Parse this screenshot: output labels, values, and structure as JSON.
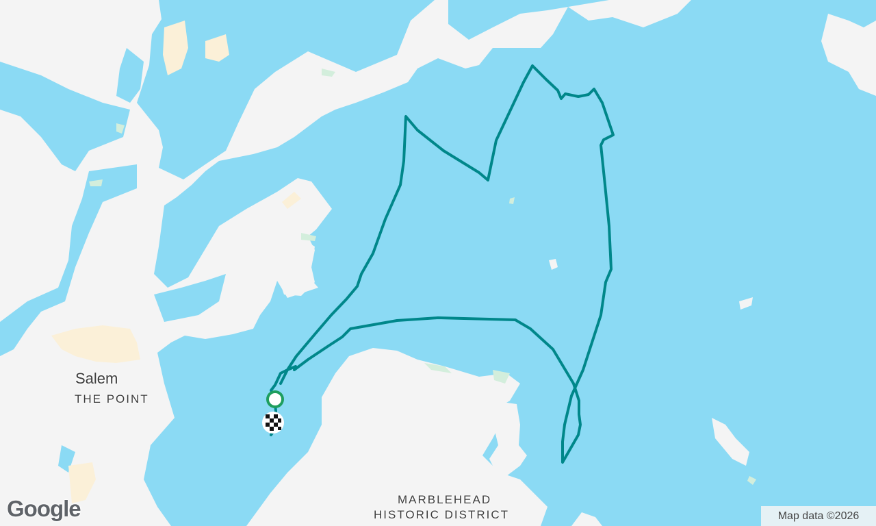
{
  "map": {
    "labels": {
      "city": "Salem",
      "neighborhood": "THE POINT",
      "district_line1": "MARBLEHEAD",
      "district_line2": "HISTORIC DISTRICT"
    },
    "logo_text": "Google",
    "attribution": "Map data ©2026",
    "colors": {
      "water": "#8bdaf4",
      "land": "#f4f4f4",
      "park": "#d3eedc",
      "urban": "#fbf0d8",
      "route": "#00878a",
      "start_marker": "#1e9e5e"
    },
    "markers": [
      {
        "type": "start",
        "icon": "start-circle-icon"
      },
      {
        "type": "finish",
        "icon": "checkered-flag-icon"
      }
    ]
  }
}
